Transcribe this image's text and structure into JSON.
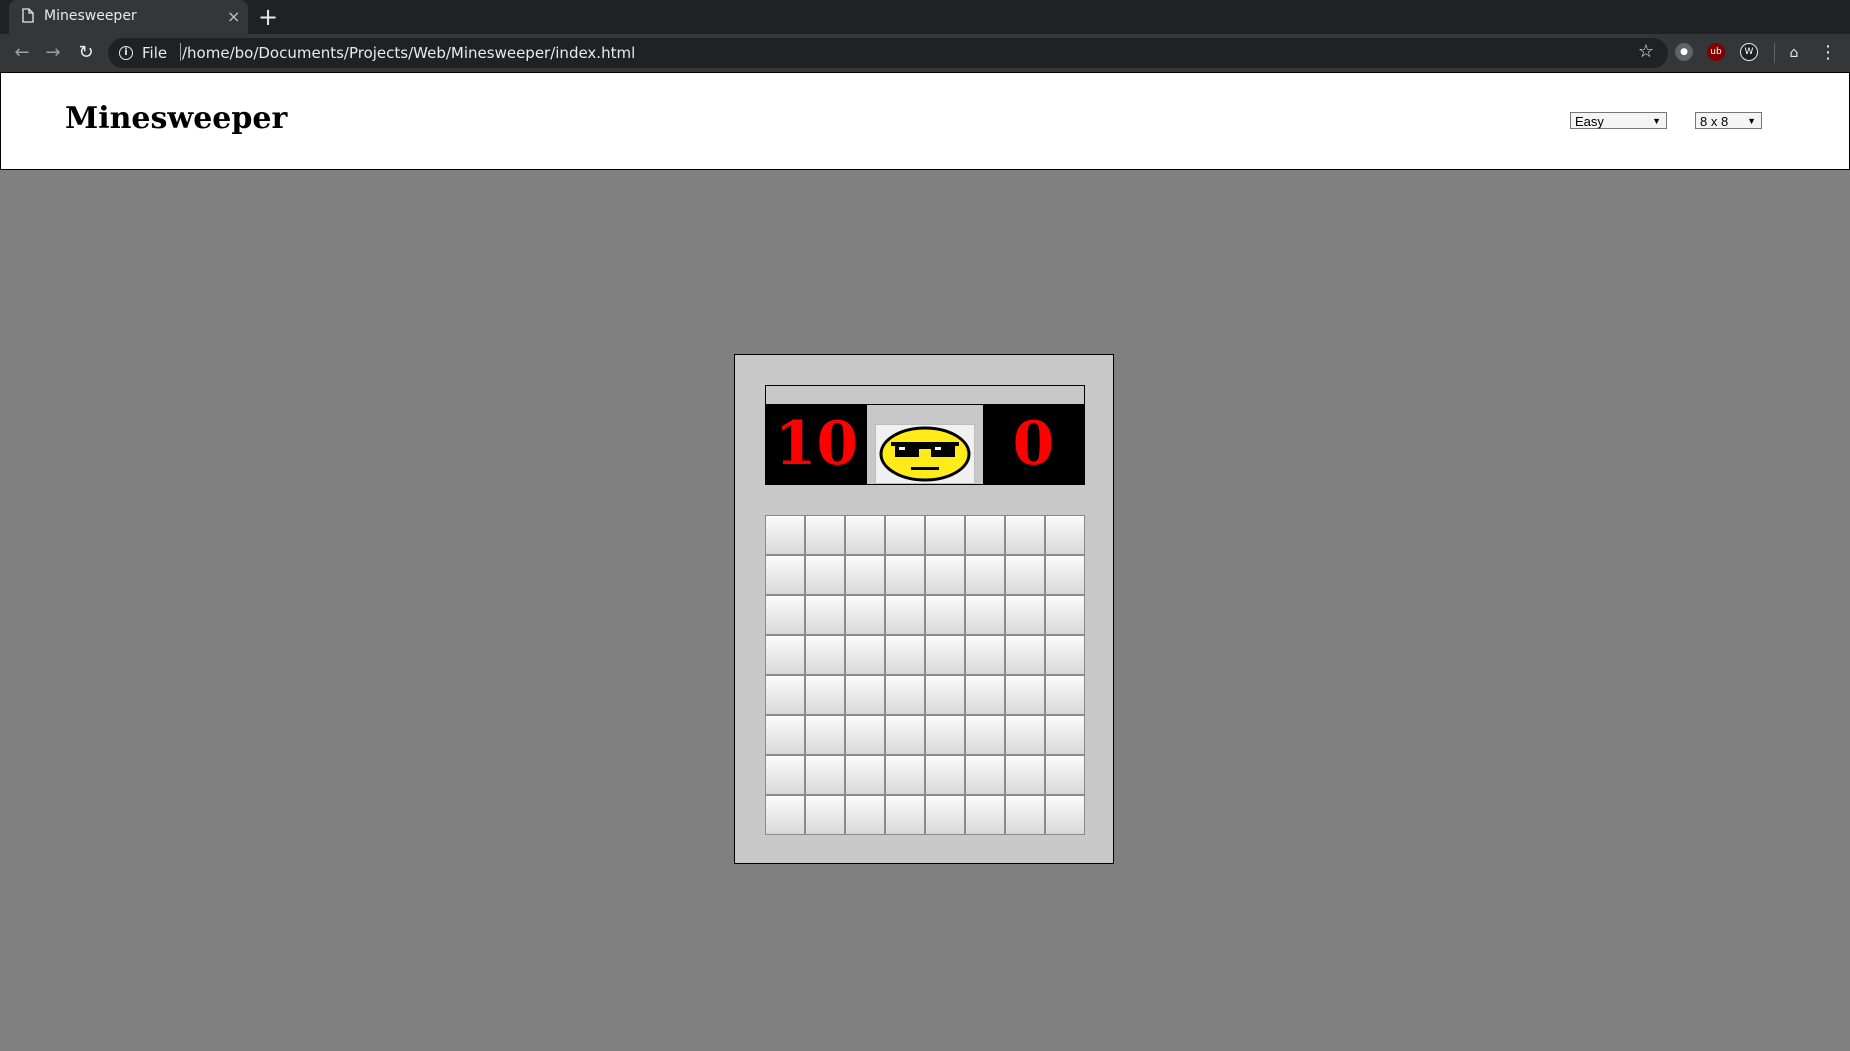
{
  "browser": {
    "tab_title": "Minesweeper",
    "new_tab_label": "+",
    "close_label": "×",
    "url_scheme": "File",
    "url": "/home/bo/Documents/Projects/Web/Minesweeper/index.html"
  },
  "header": {
    "title": "Minesweeper",
    "difficulty": {
      "selected": "Easy"
    },
    "board_size": {
      "selected": "8 x 8"
    }
  },
  "game": {
    "mine_counter": "10",
    "timer": "0",
    "face": "sunglasses-face",
    "rows": 8,
    "cols": 8,
    "cells_state": "all-unrevealed"
  },
  "colors": {
    "page_background": "#808080",
    "game_panel": "#c8c8c8",
    "counter_digits": "#ff0000",
    "counter_background": "#000000",
    "face_yellow": "#ffeb1a"
  }
}
